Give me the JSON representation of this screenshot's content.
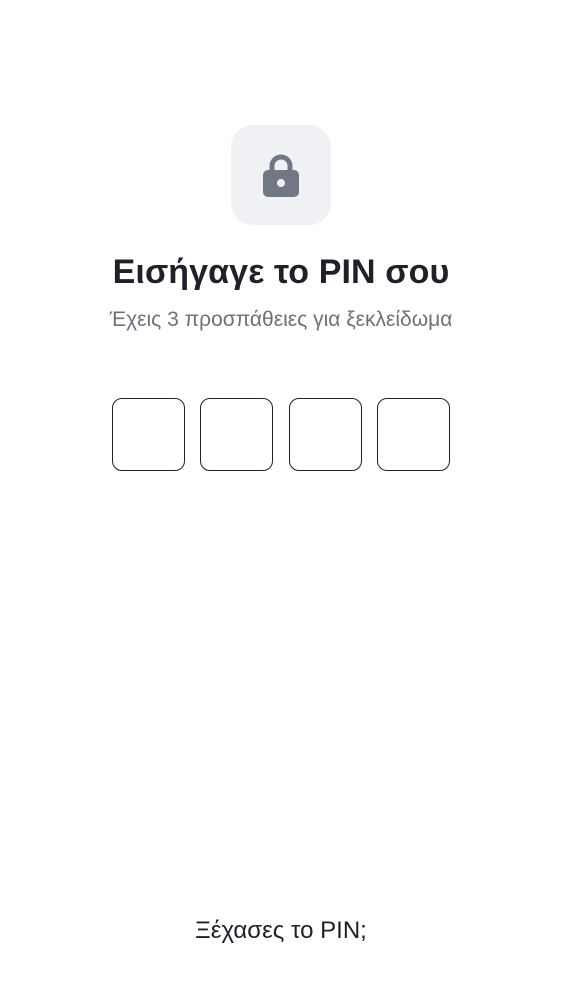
{
  "lock": {
    "icon": "lock-icon",
    "tile_color": "#f0f1f5",
    "icon_color": "#717884"
  },
  "title": "Εισήγαγε το PIN σου",
  "subtitle": "Έχεις 3 προσπάθειες για ξεκλείδωμα",
  "pin": {
    "digits": [
      "",
      "",
      "",
      ""
    ]
  },
  "forgot_label": "Ξέχασες το PIN;"
}
